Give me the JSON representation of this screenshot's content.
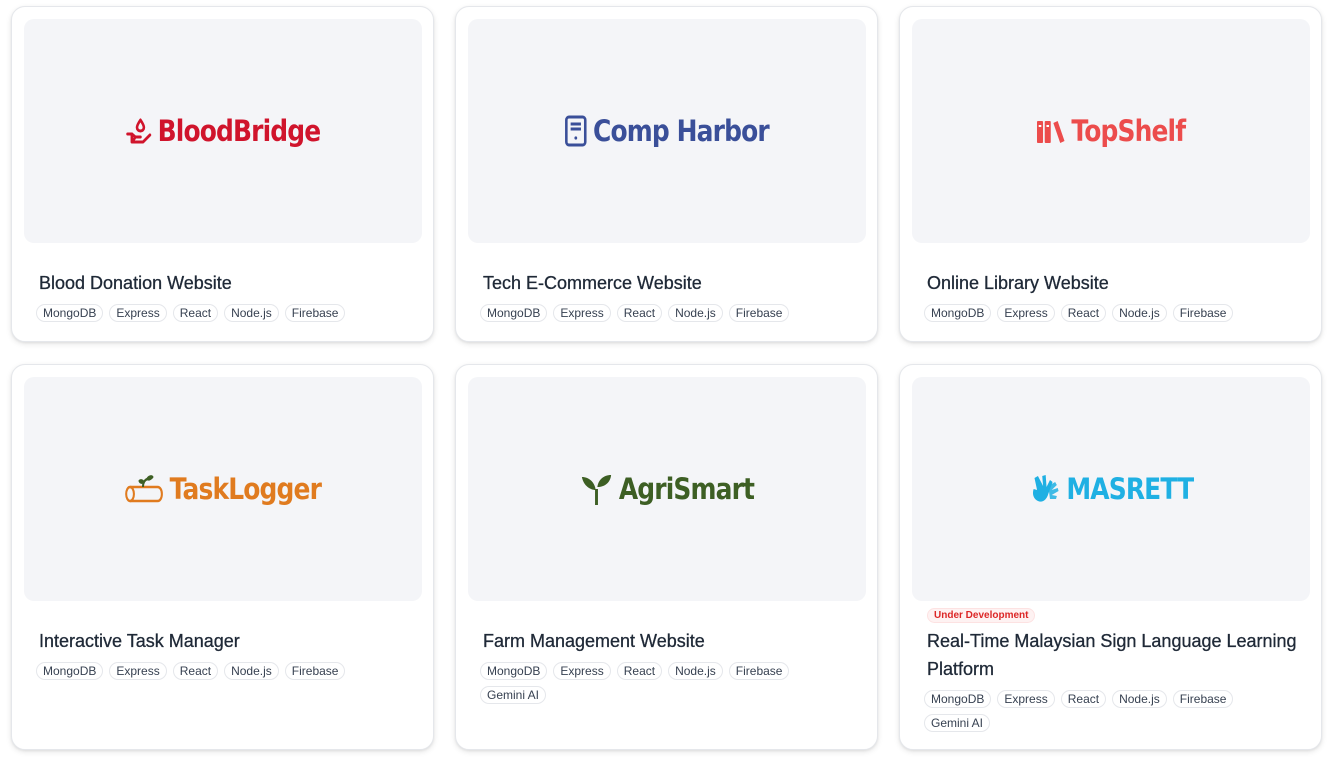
{
  "projects": [
    {
      "title": "Blood Donation Website",
      "logo": {
        "text": "BloodBridge",
        "icon": "hand-drop-icon",
        "color": "#d0142c"
      },
      "badge": "",
      "tags": [
        "MongoDB",
        "Express",
        "React",
        "Node.js",
        "Firebase"
      ]
    },
    {
      "title": "Tech E-Commerce Website",
      "logo": {
        "text": "Comp Harbor",
        "icon": "computer-tower-icon",
        "color": "#3a4f99"
      },
      "badge": "",
      "tags": [
        "MongoDB",
        "Express",
        "React",
        "Node.js",
        "Firebase"
      ]
    },
    {
      "title": "Online Library Website",
      "logo": {
        "text": "TopShelf",
        "icon": "books-icon",
        "color": "#ec4c4c"
      },
      "badge": "",
      "tags": [
        "MongoDB",
        "Express",
        "React",
        "Node.js",
        "Firebase"
      ]
    },
    {
      "title": "Interactive Task Manager",
      "logo": {
        "text": "TaskLogger",
        "icon": "log-sprout-icon",
        "color": "#e07b1f"
      },
      "badge": "",
      "tags": [
        "MongoDB",
        "Express",
        "React",
        "Node.js",
        "Firebase"
      ]
    },
    {
      "title": "Farm Management Website",
      "logo": {
        "text": "AgriSmart",
        "icon": "sprout-icon",
        "color": "#3d5f24"
      },
      "badge": "",
      "tags": [
        "MongoDB",
        "Express",
        "React",
        "Node.js",
        "Firebase",
        "Gemini AI"
      ]
    },
    {
      "title": "Real-Time Malaysian Sign Language Learning Platform",
      "logo": {
        "text": "MASRETT",
        "icon": "sign-hands-icon",
        "color": "#1fb0e3"
      },
      "badge": "Under Development",
      "tags": [
        "MongoDB",
        "Express",
        "React",
        "Node.js",
        "Firebase",
        "Gemini AI"
      ]
    }
  ]
}
